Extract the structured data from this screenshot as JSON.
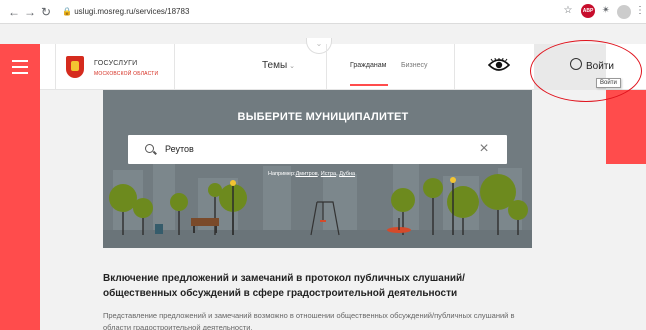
{
  "browser": {
    "url": "uslugi.mosreg.ru/services/18783",
    "back_icon": "arrow-left-icon",
    "forward_icon": "arrow-right-icon",
    "reload_icon": "reload-icon",
    "abp_label": "ABP"
  },
  "header": {
    "logo_title": "ГОСУСЛУГИ",
    "logo_subtitle": "МОСКОВСКОЙ ОБЛАСТИ",
    "themes_label": "Темы",
    "tabs": [
      {
        "label": "Гражданам",
        "active": true
      },
      {
        "label": "Бизнесу",
        "active": false
      }
    ],
    "login_label": "Войти",
    "login_tooltip": "Войти",
    "accent_color": "#ff4c4c"
  },
  "hero": {
    "title": "ВЫБЕРИТЕ МУНИЦИПАЛИТЕТ",
    "search_value": "Реутов",
    "hint_prefix": "Например:",
    "hint_links": [
      "Дмитров",
      "Истра",
      "Дубна"
    ]
  },
  "article": {
    "title_line1": "Включение предложений и замечаний в протокол публичных слушаний/",
    "title_line2": "общественных обсуждений в сфере градостроительной деятельности",
    "text_line1": "Представление предложений и замечаний возможно в отношении общественных обсуждений/публичных слушаний в",
    "text_line2": "области градостроительной деятельности."
  }
}
